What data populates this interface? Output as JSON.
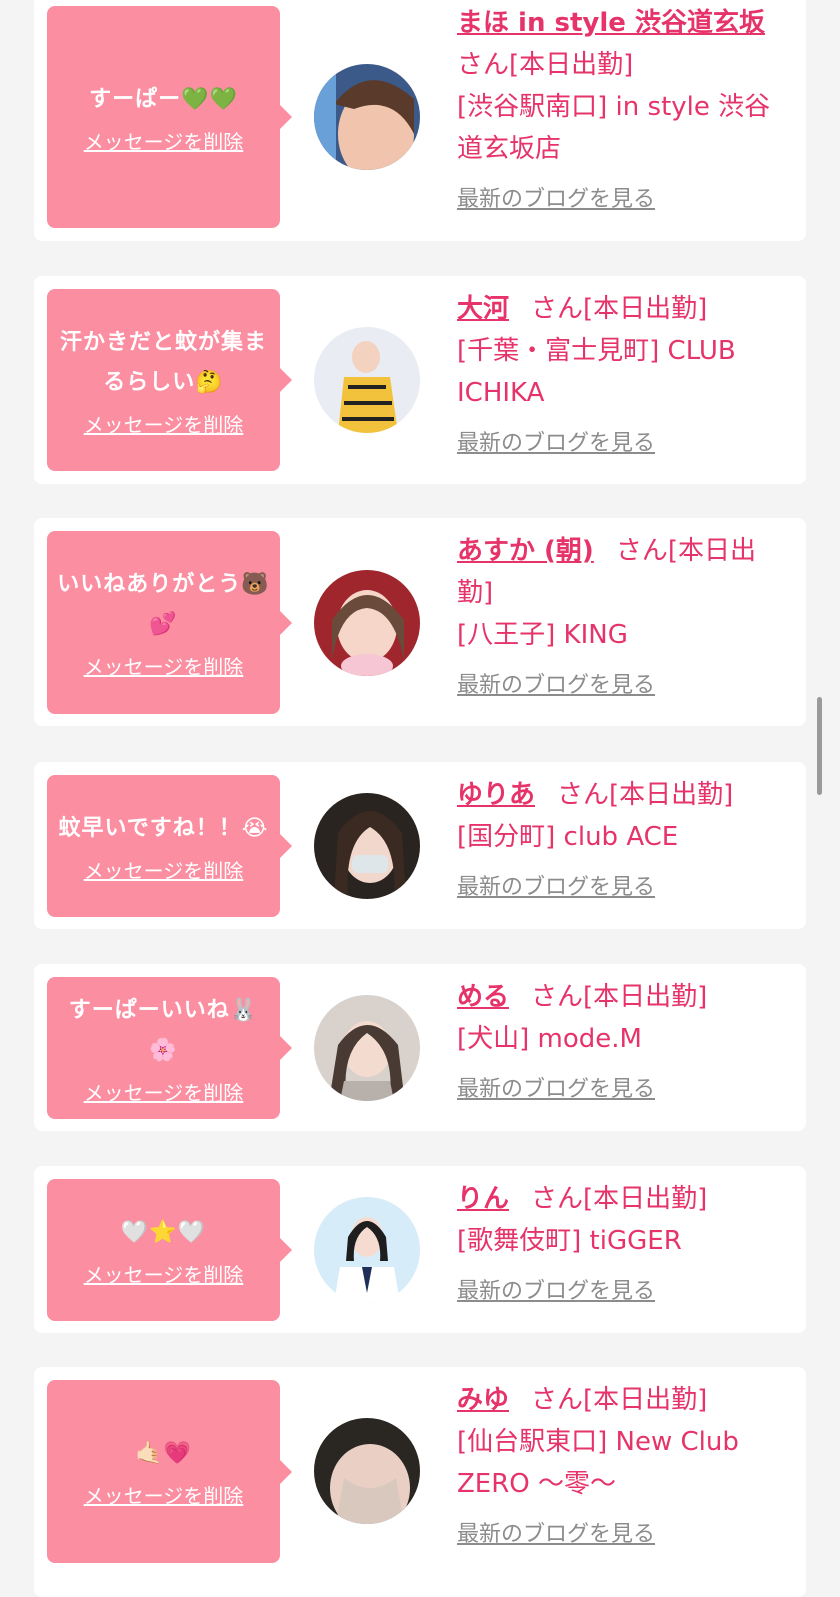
{
  "accent_color": "#e6336a",
  "bubble_color": "#fb8ea1",
  "common": {
    "delete_label": "メッセージを削除",
    "blog_label": "最新のブログを見る"
  },
  "items": [
    {
      "message": "すーぱー💚💚",
      "name": "まほ in style 渋谷道玄坂",
      "status": "さん[本日出勤]",
      "shop": "[渋谷駅南口] in style 渋谷道玄坂店"
    },
    {
      "message": "汗かきだと蚊が集まるらしい🤔",
      "name": "大河",
      "status": "さん[本日出勤]",
      "shop": "[千葉・富士見町] CLUB ICHIKA"
    },
    {
      "message": "いいねありがとう🐻💕",
      "name": "あすか (朝)",
      "status": "さん[本日出勤]",
      "shop": "[八王子] KING"
    },
    {
      "message": "蚊早いですね！！😭",
      "name": "ゆりあ",
      "status": "さん[本日出勤]",
      "shop": "[国分町] club ACE"
    },
    {
      "message": "すーぱーいいね🐰🌸",
      "name": "める",
      "status": "さん[本日出勤]",
      "shop": "[犬山] mode.M"
    },
    {
      "message": "🤍⭐🤍",
      "name": "りん",
      "status": "さん[本日出勤]",
      "shop": "[歌舞伎町] tiGGER"
    },
    {
      "message": "🤙🏻💗",
      "name": "みゆ",
      "status": "さん[本日出勤]",
      "shop": "[仙台駅東口] New Club ZERO 〜零〜"
    }
  ]
}
